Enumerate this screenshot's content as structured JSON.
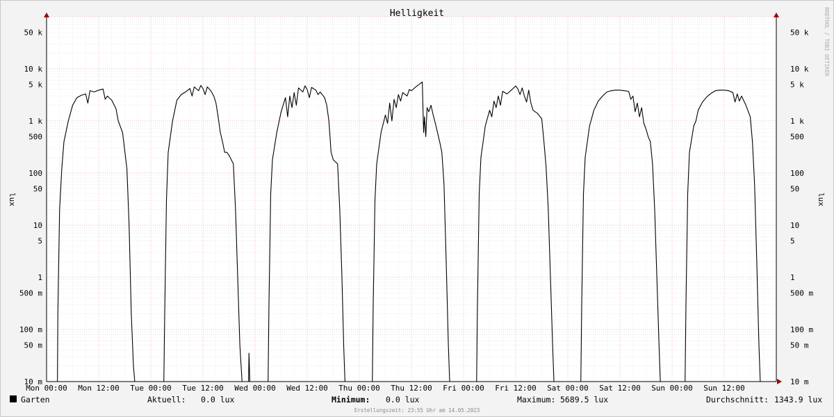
{
  "chart_data": {
    "type": "line",
    "title": "Helligkeit",
    "ylabel": "lux",
    "ylabel_right": "lux",
    "y_scale": "log",
    "ylim": [
      0.01,
      100000
    ],
    "y_ticks": [
      {
        "value": 50000,
        "label": "50 k"
      },
      {
        "value": 10000,
        "label": "10 k"
      },
      {
        "value": 5000,
        "label": "5 k"
      },
      {
        "value": 1000,
        "label": "1 k"
      },
      {
        "value": 500,
        "label": "500"
      },
      {
        "value": 100,
        "label": "100"
      },
      {
        "value": 50,
        "label": "50"
      },
      {
        "value": 10,
        "label": "10"
      },
      {
        "value": 5,
        "label": "5"
      },
      {
        "value": 1,
        "label": "1"
      },
      {
        "value": 0.5,
        "label": "500 m"
      },
      {
        "value": 0.1,
        "label": "100 m"
      },
      {
        "value": 0.05,
        "label": "50 m"
      },
      {
        "value": 0.01,
        "label": "10 m"
      }
    ],
    "x_unit": "hours",
    "xlim": [
      0,
      168
    ],
    "x_ticks": [
      {
        "value": 0,
        "label": "Mon 00:00"
      },
      {
        "value": 12,
        "label": "Mon 12:00"
      },
      {
        "value": 24,
        "label": "Tue 00:00"
      },
      {
        "value": 36,
        "label": "Tue 12:00"
      },
      {
        "value": 48,
        "label": "Wed 00:00"
      },
      {
        "value": 60,
        "label": "Wed 12:00"
      },
      {
        "value": 72,
        "label": "Thu 00:00"
      },
      {
        "value": 84,
        "label": "Thu 12:00"
      },
      {
        "value": 96,
        "label": "Fri 00:00"
      },
      {
        "value": 108,
        "label": "Fri 12:00"
      },
      {
        "value": 120,
        "label": "Sat 00:00"
      },
      {
        "value": 132,
        "label": "Sat 12:00"
      },
      {
        "value": 144,
        "label": "Sun 00:00"
      },
      {
        "value": 156,
        "label": "Sun 12:00"
      }
    ],
    "grid": true,
    "series": [
      {
        "name": "Garten",
        "color": "#000000",
        "points": [
          [
            0,
            0.01
          ],
          [
            2.5,
            0.01
          ],
          [
            2.6,
            0.2
          ],
          [
            3.0,
            20
          ],
          [
            3.5,
            120
          ],
          [
            4.0,
            400
          ],
          [
            5.0,
            1000
          ],
          [
            6.0,
            2000
          ],
          [
            7.0,
            2800
          ],
          [
            8.0,
            3100
          ],
          [
            9.0,
            3300
          ],
          [
            9.5,
            2200
          ],
          [
            10.0,
            3800
          ],
          [
            11.0,
            3600
          ],
          [
            12.0,
            3900
          ],
          [
            13.0,
            4100
          ],
          [
            13.5,
            2600
          ],
          [
            14.0,
            3000
          ],
          [
            15.0,
            2500
          ],
          [
            16.0,
            1700
          ],
          [
            16.5,
            1000
          ],
          [
            17.5,
            600
          ],
          [
            18.5,
            120
          ],
          [
            19.0,
            10
          ],
          [
            19.5,
            0.2
          ],
          [
            20.0,
            0.02
          ],
          [
            20.3,
            0.01
          ],
          [
            24,
            0.01
          ],
          [
            27.0,
            0.01
          ],
          [
            27.2,
            0.2
          ],
          [
            27.6,
            30
          ],
          [
            28.0,
            250
          ],
          [
            29.0,
            1000
          ],
          [
            30.0,
            2500
          ],
          [
            31.0,
            3200
          ],
          [
            32.0,
            3600
          ],
          [
            33.0,
            4200
          ],
          [
            33.5,
            3000
          ],
          [
            34.0,
            4500
          ],
          [
            35.0,
            3800
          ],
          [
            35.5,
            4800
          ],
          [
            36.0,
            4200
          ],
          [
            36.5,
            3200
          ],
          [
            37.0,
            4500
          ],
          [
            37.8,
            3800
          ],
          [
            38.5,
            3000
          ],
          [
            39.0,
            2200
          ],
          [
            39.5,
            1200
          ],
          [
            40.0,
            600
          ],
          [
            40.5,
            400
          ],
          [
            41.0,
            250
          ],
          [
            41.5,
            250
          ],
          [
            42.0,
            220
          ],
          [
            43.0,
            150
          ],
          [
            43.5,
            20
          ],
          [
            44.0,
            1
          ],
          [
            44.5,
            0.05
          ],
          [
            45.0,
            0.01
          ],
          [
            45.3,
            0.01
          ],
          [
            46.5,
            0.01
          ],
          [
            46.6,
            0.035
          ],
          [
            46.8,
            0.01
          ],
          [
            48,
            0.01
          ],
          [
            51.0,
            0.01
          ],
          [
            51.2,
            0.3
          ],
          [
            51.6,
            40
          ],
          [
            52.0,
            180
          ],
          [
            53.0,
            600
          ],
          [
            54.0,
            1500
          ],
          [
            55.0,
            2800
          ],
          [
            55.5,
            1200
          ],
          [
            56.0,
            3000
          ],
          [
            56.5,
            1800
          ],
          [
            57.0,
            3500
          ],
          [
            57.5,
            2000
          ],
          [
            58.0,
            4300
          ],
          [
            59.0,
            3600
          ],
          [
            59.5,
            4700
          ],
          [
            60.0,
            4000
          ],
          [
            60.5,
            2800
          ],
          [
            61.0,
            4400
          ],
          [
            62.0,
            3900
          ],
          [
            62.5,
            3200
          ],
          [
            63.0,
            3600
          ],
          [
            64.0,
            2800
          ],
          [
            64.5,
            2000
          ],
          [
            65.0,
            1000
          ],
          [
            65.5,
            250
          ],
          [
            66.0,
            180
          ],
          [
            67.0,
            150
          ],
          [
            67.5,
            20
          ],
          [
            68.0,
            1
          ],
          [
            68.4,
            0.05
          ],
          [
            68.7,
            0.01
          ],
          [
            72,
            0.01
          ],
          [
            75.0,
            0.01
          ],
          [
            75.2,
            0.3
          ],
          [
            75.6,
            30
          ],
          [
            76.0,
            150
          ],
          [
            77.0,
            600
          ],
          [
            78.0,
            1300
          ],
          [
            78.5,
            900
          ],
          [
            79.0,
            2200
          ],
          [
            79.5,
            1000
          ],
          [
            80.0,
            2600
          ],
          [
            80.5,
            1800
          ],
          [
            81.0,
            3200
          ],
          [
            81.5,
            2400
          ],
          [
            82.0,
            3500
          ],
          [
            83.0,
            3000
          ],
          [
            83.5,
            4000
          ],
          [
            84.0,
            3800
          ],
          [
            85.0,
            4500
          ],
          [
            86.0,
            5200
          ],
          [
            86.5,
            5600
          ],
          [
            86.8,
            600
          ],
          [
            87.0,
            1200
          ],
          [
            87.3,
            500
          ],
          [
            87.6,
            1800
          ],
          [
            88.0,
            1500
          ],
          [
            88.5,
            2000
          ],
          [
            89.0,
            1300
          ],
          [
            89.5,
            900
          ],
          [
            90.0,
            600
          ],
          [
            90.5,
            400
          ],
          [
            91.0,
            250
          ],
          [
            91.5,
            60
          ],
          [
            92.0,
            2
          ],
          [
            92.5,
            0.05
          ],
          [
            92.8,
            0.01
          ],
          [
            96,
            0.01
          ],
          [
            99.0,
            0.01
          ],
          [
            99.2,
            0.3
          ],
          [
            99.6,
            40
          ],
          [
            100.0,
            200
          ],
          [
            101.0,
            800
          ],
          [
            102.0,
            1600
          ],
          [
            102.5,
            1200
          ],
          [
            103.0,
            2400
          ],
          [
            103.5,
            1800
          ],
          [
            104.0,
            3000
          ],
          [
            104.5,
            2000
          ],
          [
            105.0,
            3700
          ],
          [
            106.0,
            3300
          ],
          [
            107.0,
            3900
          ],
          [
            108.0,
            4700
          ],
          [
            108.5,
            4100
          ],
          [
            109.0,
            3200
          ],
          [
            109.5,
            4300
          ],
          [
            110.0,
            3000
          ],
          [
            110.5,
            2300
          ],
          [
            111.0,
            3900
          ],
          [
            111.5,
            2200
          ],
          [
            112.0,
            1600
          ],
          [
            113.0,
            1400
          ],
          [
            114.0,
            1100
          ],
          [
            114.5,
            400
          ],
          [
            115.0,
            130
          ],
          [
            115.5,
            20
          ],
          [
            116.0,
            1
          ],
          [
            116.5,
            0.05
          ],
          [
            116.8,
            0.01
          ],
          [
            120,
            0.01
          ],
          [
            123.0,
            0.01
          ],
          [
            123.2,
            0.3
          ],
          [
            123.6,
            40
          ],
          [
            124.0,
            200
          ],
          [
            125.0,
            800
          ],
          [
            126.0,
            1600
          ],
          [
            127.0,
            2400
          ],
          [
            128.0,
            3000
          ],
          [
            129.0,
            3600
          ],
          [
            130.0,
            3800
          ],
          [
            131.0,
            3900
          ],
          [
            132.0,
            3900
          ],
          [
            133.0,
            3800
          ],
          [
            134.0,
            3700
          ],
          [
            134.5,
            2600
          ],
          [
            135.0,
            3000
          ],
          [
            135.5,
            1500
          ],
          [
            136.0,
            2200
          ],
          [
            136.5,
            1200
          ],
          [
            137.0,
            1800
          ],
          [
            137.5,
            900
          ],
          [
            138.0,
            700
          ],
          [
            138.5,
            500
          ],
          [
            139.0,
            400
          ],
          [
            139.5,
            150
          ],
          [
            140.0,
            20
          ],
          [
            140.5,
            1
          ],
          [
            141.0,
            0.05
          ],
          [
            141.3,
            0.01
          ],
          [
            144,
            0.01
          ],
          [
            147.0,
            0.01
          ],
          [
            147.2,
            0.3
          ],
          [
            147.6,
            40
          ],
          [
            148.0,
            250
          ],
          [
            149.0,
            800
          ],
          [
            149.5,
            1000
          ],
          [
            150.0,
            1600
          ],
          [
            151.0,
            2300
          ],
          [
            152.0,
            2900
          ],
          [
            153.0,
            3400
          ],
          [
            154.0,
            3800
          ],
          [
            155.0,
            3900
          ],
          [
            156.0,
            3900
          ],
          [
            157.0,
            3800
          ],
          [
            158.0,
            3500
          ],
          [
            158.5,
            2300
          ],
          [
            159.0,
            3300
          ],
          [
            159.5,
            2400
          ],
          [
            160.0,
            3000
          ],
          [
            161.0,
            2000
          ],
          [
            162.0,
            1200
          ],
          [
            162.5,
            400
          ],
          [
            163.0,
            60
          ],
          [
            163.5,
            2
          ],
          [
            164.0,
            0.05
          ],
          [
            164.3,
            0.01
          ],
          [
            168,
            0.01
          ]
        ]
      }
    ]
  },
  "watermark": "RRDTOOL / TOBI OETIKER",
  "legend": {
    "name": "Garten",
    "aktuell_label": "Aktuell:",
    "aktuell_value": "0.0 lux",
    "minimum_label": "Minimum:",
    "minimum_value": "0.0 lux",
    "maximum_label": "Maximum:",
    "maximum_value": "5689.5 lux",
    "durchschnitt_label": "Durchschnitt:",
    "durchschnitt_value": "1343.9 lux"
  },
  "footer": "Erstellungszeit: 23:55 Uhr am 14.05.2023"
}
